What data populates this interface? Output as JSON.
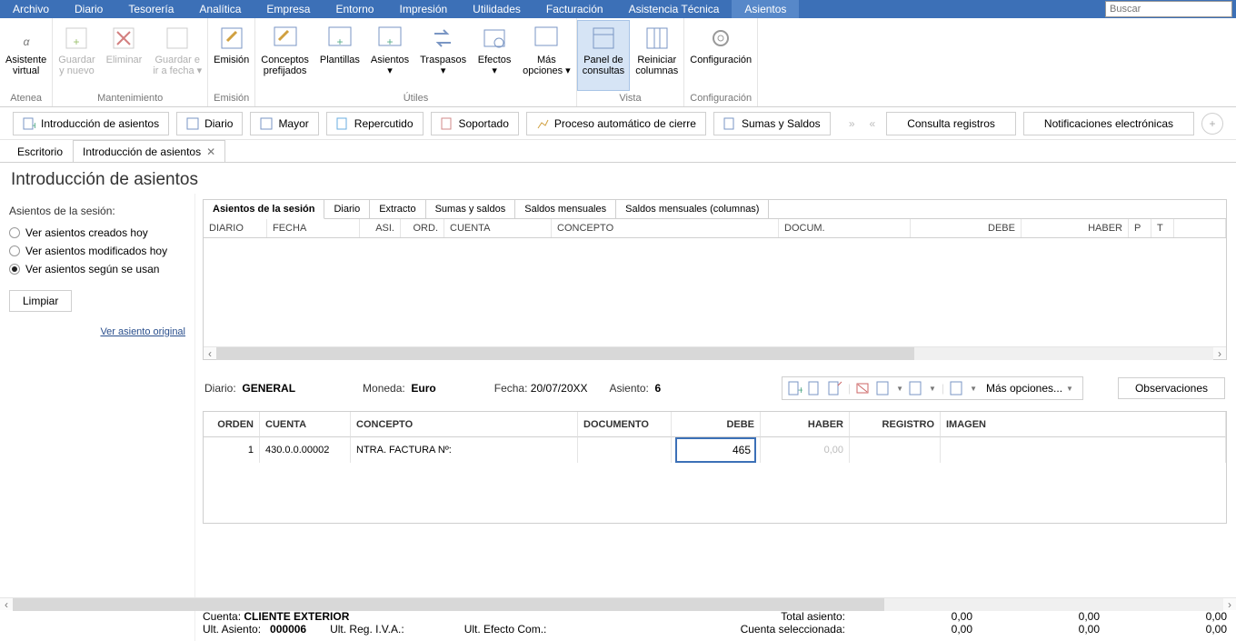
{
  "menu": [
    "Archivo",
    "Diario",
    "Tesorería",
    "Analítica",
    "Empresa",
    "Entorno",
    "Impresión",
    "Utilidades",
    "Facturación",
    "Asistencia Técnica",
    "Asientos"
  ],
  "menuActive": 10,
  "search_placeholder": "Buscar",
  "ribbon": {
    "groups": [
      {
        "title": "Atenea",
        "buttons": [
          {
            "lbl1": "Asistente",
            "lbl2": "virtual"
          }
        ]
      },
      {
        "title": "Mantenimiento",
        "buttons": [
          {
            "lbl1": "Guardar",
            "lbl2": "y nuevo",
            "disabled": true
          },
          {
            "lbl1": "Eliminar",
            "lbl2": "",
            "disabled": true
          },
          {
            "lbl1": "Guardar e",
            "lbl2": "ir a fecha ▾",
            "disabled": true
          }
        ]
      },
      {
        "title": "Emisión",
        "buttons": [
          {
            "lbl1": "Emisión",
            "lbl2": ""
          }
        ]
      },
      {
        "title": "Útiles",
        "buttons": [
          {
            "lbl1": "Conceptos",
            "lbl2": "prefijados"
          },
          {
            "lbl1": "Plantillas",
            "lbl2": ""
          },
          {
            "lbl1": "Asientos",
            "lbl2": "▾"
          },
          {
            "lbl1": "Traspasos",
            "lbl2": "▾"
          },
          {
            "lbl1": "Efectos",
            "lbl2": "▾"
          },
          {
            "lbl1": "Más",
            "lbl2": "opciones ▾"
          }
        ]
      },
      {
        "title": "Vista",
        "buttons": [
          {
            "lbl1": "Panel de",
            "lbl2": "consultas",
            "active": true
          },
          {
            "lbl1": "Reiniciar",
            "lbl2": "columnas"
          }
        ]
      },
      {
        "title": "Configuración",
        "buttons": [
          {
            "lbl1": "Configuración",
            "lbl2": ""
          }
        ]
      }
    ]
  },
  "qa": [
    "Introducción de asientos",
    "Diario",
    "Mayor",
    "Repercutido",
    "Soportado",
    "Proceso automático de cierre",
    "Sumas y Saldos"
  ],
  "qa_right": [
    "Consulta registros",
    "Notificaciones electrónicas"
  ],
  "tabs": [
    {
      "label": "Escritorio",
      "closable": false
    },
    {
      "label": "Introducción de asientos",
      "closable": true
    }
  ],
  "page_title": "Introducción de asientos",
  "sidebar": {
    "title": "Asientos de la sesión:",
    "radios": [
      {
        "label": "Ver asientos creados hoy",
        "checked": false
      },
      {
        "label": "Ver asientos modificados hoy",
        "checked": false
      },
      {
        "label": "Ver asientos según se usan",
        "checked": true
      }
    ],
    "button": "Limpiar",
    "link": "Ver asiento original"
  },
  "subtabs": [
    "Asientos de la sesión",
    "Diario",
    "Extracto",
    "Sumas y saldos",
    "Saldos mensuales",
    "Saldos mensuales (columnas)"
  ],
  "grid1_headers": [
    "DIARIO",
    "FECHA",
    "ASI.",
    "ORD.",
    "CUENTA",
    "CONCEPTO",
    "DOCUM.",
    "DEBE",
    "HABER",
    "P",
    "T"
  ],
  "info": {
    "diario_lbl": "Diario:",
    "diario_val": "GENERAL",
    "moneda_lbl": "Moneda:",
    "moneda_val": "Euro",
    "fecha_lbl": "Fecha:",
    "fecha_val": "20/07/20XX",
    "asiento_lbl": "Asiento:",
    "asiento_val": "6",
    "more_label": "Más opciones...",
    "obs_label": "Observaciones"
  },
  "grid2_headers": [
    "ORDEN",
    "CUENTA",
    "CONCEPTO",
    "DOCUMENTO",
    "DEBE",
    "HABER",
    "REGISTRO",
    "IMAGEN"
  ],
  "grid2_row": {
    "orden": "1",
    "cuenta": "430.0.0.00002",
    "concepto": "NTRA. FACTURA Nº:",
    "documento": "",
    "debe": "465",
    "haber": "0,00",
    "registro": "",
    "imagen": ""
  },
  "footer": {
    "cuenta_lbl": "Cuenta:",
    "cuenta_val": "CLIENTE EXTERIOR",
    "ultasiento_lbl": "Ult. Asiento:",
    "ultasiento_val": "000006",
    "ultreg_lbl": "Ult. Reg. I.V.A.:",
    "ultefecto_lbl": "Ult. Efecto Com.:",
    "total_lbl": "Total asiento:",
    "sel_lbl": "Cuenta seleccionada:",
    "z1": "0,00",
    "z2": "0,00",
    "z3": "0,00"
  }
}
